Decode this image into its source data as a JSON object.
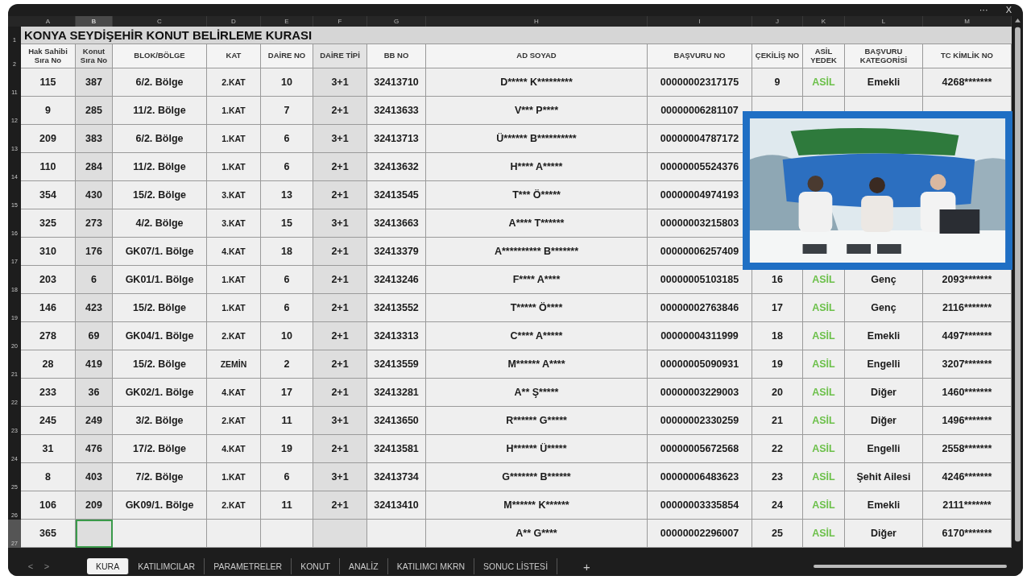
{
  "window": {
    "menu": "···",
    "close": "X"
  },
  "sheet": {
    "title": "KONYA SEYDİŞEHİR KONUT BELİRLEME KURASI",
    "title_row": "1",
    "header_row": "2",
    "columns": [
      {
        "letter": "A",
        "label": "Hak Sahibi Sıra No",
        "selected": false
      },
      {
        "letter": "B",
        "label": "Konut Sıra No",
        "selected": true
      },
      {
        "letter": "C",
        "label": "BLOK/BÖLGE",
        "selected": false
      },
      {
        "letter": "D",
        "label": "KAT",
        "selected": false
      },
      {
        "letter": "E",
        "label": "DAİRE NO",
        "selected": false
      },
      {
        "letter": "F",
        "label": "DAİRE TİPİ",
        "selected": false
      },
      {
        "letter": "G",
        "label": "BB NO",
        "selected": false
      },
      {
        "letter": "H",
        "label": "AD SOYAD",
        "selected": false
      },
      {
        "letter": "I",
        "label": "BAŞVURU NO",
        "selected": false
      },
      {
        "letter": "J",
        "label": "ÇEKİLİŞ NO",
        "selected": false
      },
      {
        "letter": "K",
        "label": "ASİL YEDEK",
        "selected": false
      },
      {
        "letter": "L",
        "label": "BAŞVURU KATEGORİSİ",
        "selected": false
      },
      {
        "letter": "M",
        "label": "TC KİMLİK NO",
        "selected": false
      }
    ],
    "rows": [
      {
        "row_number": "11",
        "cells": [
          "115",
          "387",
          "6/2. Bölge",
          "2.KAT",
          "10",
          "3+1",
          "32413710",
          "D***** K*********",
          "00000002317175",
          "9",
          "ASİL",
          "Emekli",
          "4268*******"
        ]
      },
      {
        "row_number": "12",
        "cells": [
          "9",
          "285",
          "11/2. Bölge",
          "1.KAT",
          "7",
          "2+1",
          "32413633",
          "V*** P****",
          "00000006281107"
        ]
      },
      {
        "row_number": "13",
        "cells": [
          "209",
          "383",
          "6/2. Bölge",
          "1.KAT",
          "6",
          "3+1",
          "32413713",
          "Ü****** B**********",
          "00000004787172"
        ]
      },
      {
        "row_number": "14",
        "cells": [
          "110",
          "284",
          "11/2. Bölge",
          "1.KAT",
          "6",
          "2+1",
          "32413632",
          "H**** A*****",
          "00000005524376"
        ]
      },
      {
        "row_number": "15",
        "cells": [
          "354",
          "430",
          "15/2. Bölge",
          "3.KAT",
          "13",
          "2+1",
          "32413545",
          "T*** Ö*****",
          "00000004974193"
        ]
      },
      {
        "row_number": "16",
        "cells": [
          "325",
          "273",
          "4/2. Bölge",
          "3.KAT",
          "15",
          "3+1",
          "32413663",
          "A**** T******",
          "00000003215803"
        ]
      },
      {
        "row_number": "17",
        "cells": [
          "310",
          "176",
          "GK07/1. Bölge",
          "4.KAT",
          "18",
          "2+1",
          "32413379",
          "A********** B*******",
          "00000006257409"
        ]
      },
      {
        "row_number": "18",
        "cells": [
          "203",
          "6",
          "GK01/1. Bölge",
          "1.KAT",
          "6",
          "2+1",
          "32413246",
          "F**** A****",
          "00000005103185",
          "16",
          "ASİL",
          "Genç",
          "2093*******"
        ]
      },
      {
        "row_number": "19",
        "cells": [
          "146",
          "423",
          "15/2. Bölge",
          "1.KAT",
          "6",
          "2+1",
          "32413552",
          "T***** Ö****",
          "00000002763846",
          "17",
          "ASİL",
          "Genç",
          "2116*******"
        ]
      },
      {
        "row_number": "20",
        "cells": [
          "278",
          "69",
          "GK04/1. Bölge",
          "2.KAT",
          "10",
          "2+1",
          "32413313",
          "C**** A*****",
          "00000004311999",
          "18",
          "ASİL",
          "Emekli",
          "4497*******"
        ]
      },
      {
        "row_number": "21",
        "cells": [
          "28",
          "419",
          "15/2. Bölge",
          "ZEMİN",
          "2",
          "2+1",
          "32413559",
          "M****** A****",
          "00000005090931",
          "19",
          "ASİL",
          "Engelli",
          "3207*******"
        ]
      },
      {
        "row_number": "22",
        "cells": [
          "233",
          "36",
          "GK02/1. Bölge",
          "4.KAT",
          "17",
          "2+1",
          "32413281",
          "A** Ş*****",
          "00000003229003",
          "20",
          "ASİL",
          "Diğer",
          "1460*******"
        ]
      },
      {
        "row_number": "23",
        "cells": [
          "245",
          "249",
          "3/2. Bölge",
          "2.KAT",
          "11",
          "3+1",
          "32413650",
          "R****** G*****",
          "00000002330259",
          "21",
          "ASİL",
          "Diğer",
          "1496*******"
        ]
      },
      {
        "row_number": "24",
        "cells": [
          "31",
          "476",
          "17/2. Bölge",
          "4.KAT",
          "19",
          "2+1",
          "32413581",
          "H****** Ü*****",
          "00000005672568",
          "22",
          "ASİL",
          "Engelli",
          "2558*******"
        ]
      },
      {
        "row_number": "25",
        "cells": [
          "8",
          "403",
          "7/2. Bölge",
          "1.KAT",
          "6",
          "3+1",
          "32413734",
          "G******* B******",
          "00000006483623",
          "23",
          "ASİL",
          "Şehit Ailesi",
          "4246*******"
        ]
      },
      {
        "row_number": "26",
        "cells": [
          "106",
          "209",
          "GK09/1. Bölge",
          "2.KAT",
          "11",
          "2+1",
          "32413410",
          "M****** K******",
          "00000003335854",
          "24",
          "ASİL",
          "Emekli",
          "2111*******"
        ]
      },
      {
        "row_number": "27",
        "cells": [
          "365",
          null,
          null,
          null,
          null,
          null,
          null,
          "A** G****",
          "00000002296007",
          "25",
          "ASİL",
          "Diğer",
          "6170*******"
        ]
      }
    ]
  },
  "sheet_tabs": {
    "prev": "<",
    "next": ">",
    "add": "+",
    "tabs": [
      {
        "label": "KURA",
        "selected": true
      },
      {
        "label": "KATILIMCILAR",
        "selected": false
      },
      {
        "label": "PARAMETRELER",
        "selected": false
      },
      {
        "label": "KONUT",
        "selected": false
      },
      {
        "label": "ANALİZ",
        "selected": false
      },
      {
        "label": "KATILIMCI MKRN",
        "selected": false
      },
      {
        "label": "SONUC LİSTESİ",
        "selected": false
      }
    ]
  }
}
